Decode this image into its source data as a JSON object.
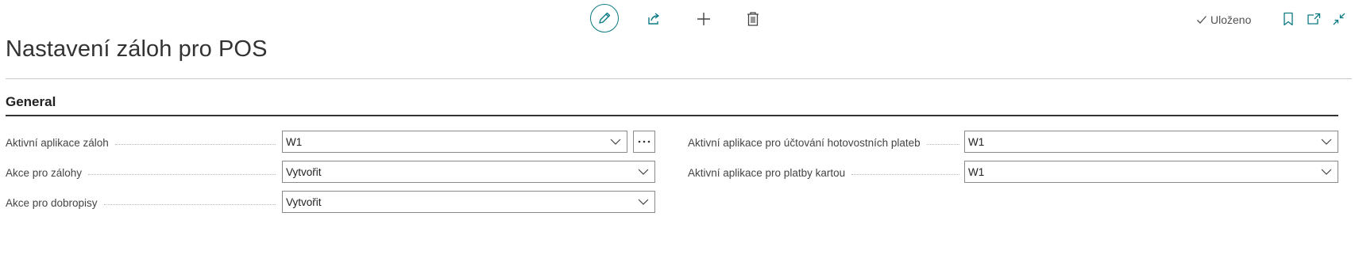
{
  "toolbar": {
    "edit_icon": "pencil-icon",
    "share_icon": "share-icon",
    "new_icon": "plus-icon",
    "delete_icon": "trash-icon",
    "saved_label": "Uloženo",
    "accent_color": "#0b7a83"
  },
  "page": {
    "title": "Nastavení záloh pro POS"
  },
  "section": {
    "title": "General"
  },
  "fields": {
    "left": [
      {
        "label": "Aktivní aplikace záloh",
        "value": "W1"
      },
      {
        "label": "Akce pro zálohy",
        "value": "Vytvořit"
      },
      {
        "label": "Akce pro dobropisy",
        "value": "Vytvořit"
      }
    ],
    "right": [
      {
        "label": "Aktivní aplikace pro účtování hotovostních plateb",
        "value": "W1"
      },
      {
        "label": "Aktivní aplikace pro platby kartou",
        "value": "W1"
      }
    ]
  }
}
